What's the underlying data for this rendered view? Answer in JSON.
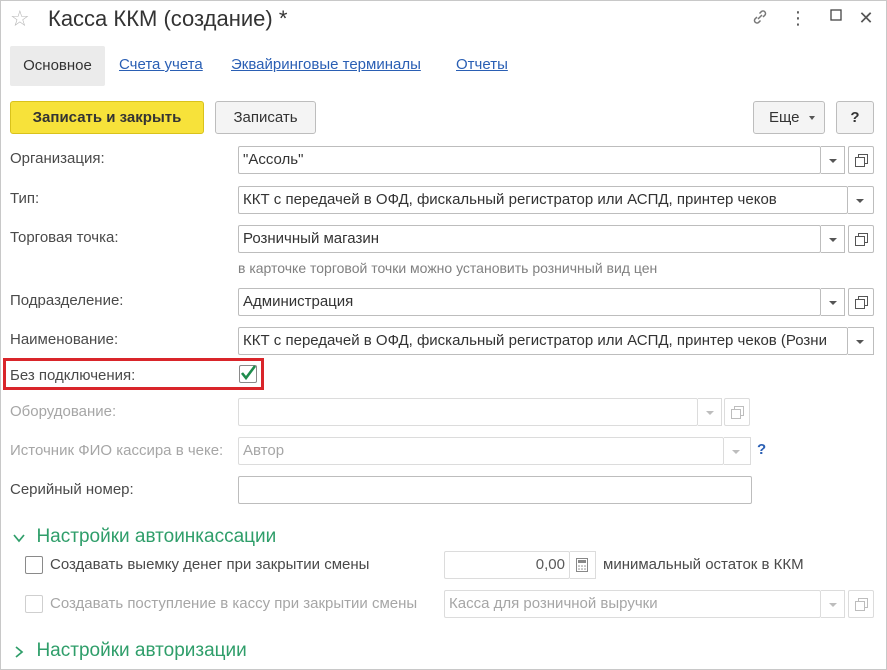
{
  "window": {
    "title": "Касса ККМ (создание) *",
    "icons": [
      "star-icon",
      "link-icon",
      "more-icon",
      "maximize-icon",
      "close-icon"
    ]
  },
  "tabs": [
    {
      "label": "Основное",
      "active": true
    },
    {
      "label": "Счета учета"
    },
    {
      "label": "Эквайринговые терминалы"
    },
    {
      "label": "Отчеты"
    }
  ],
  "toolbar": {
    "save_close": "Записать и закрыть",
    "save": "Записать",
    "more": "Еще",
    "help": "?"
  },
  "form": {
    "organization": {
      "label": "Организация:",
      "value": "\"Ассоль\""
    },
    "type": {
      "label": "Тип:",
      "value": "ККТ с передачей в ОФД, фискальный регистратор или АСПД, принтер чеков"
    },
    "outlet": {
      "label": "Торговая точка:",
      "value": "Розничный магазин"
    },
    "outlet_hint": "в карточке торговой точки можно установить розничный вид цен",
    "department": {
      "label": "Подразделение:",
      "value": "Администрация"
    },
    "name": {
      "label": "Наименование:",
      "value": "ККТ с передачей в ОФД, фискальный регистратор или АСПД, принтер чеков (Розни"
    },
    "no_connection": {
      "label": "Без подключения:",
      "checked": true
    },
    "equipment": {
      "label": "Оборудование:",
      "value": ""
    },
    "cashier_source": {
      "label": "Источник ФИО кассира в чеке:",
      "value": "Автор",
      "help": "?"
    },
    "serial": {
      "label": "Серийный номер:",
      "value": ""
    }
  },
  "sections": {
    "auto_collection": {
      "title": "Настройки автоинкассации",
      "withdraw": {
        "label": "Создавать выемку денег при закрытии смены",
        "checked": false,
        "amount": "0,00",
        "suffix": "минимальный остаток в ККМ"
      },
      "receipt": {
        "label": "Создавать поступление в кассу при закрытии смены",
        "checked": false,
        "placeholder": "Касса для розничной выручки"
      }
    },
    "authorization": {
      "title": "Настройки авторизации"
    }
  },
  "colors": {
    "accent": "#f7e23a",
    "section": "#2f9e6a",
    "link": "#2a5fb4",
    "highlight": "#d9252a"
  }
}
